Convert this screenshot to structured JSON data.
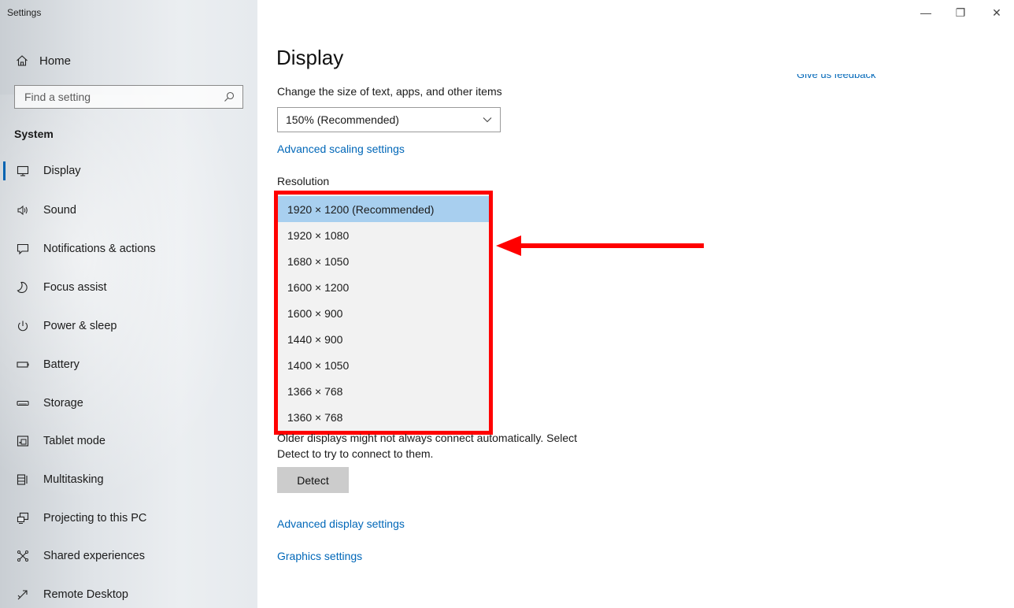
{
  "window": {
    "title": "Settings",
    "minimize_glyph": "—",
    "restore_glyph": "❐",
    "close_glyph": "✕"
  },
  "sidebar": {
    "home_label": "Home",
    "search_placeholder": "Find a setting",
    "section_label": "System",
    "items": [
      {
        "label": "Display",
        "icon": "monitor-icon",
        "active": true
      },
      {
        "label": "Sound",
        "icon": "speaker-icon"
      },
      {
        "label": "Notifications & actions",
        "icon": "notification-icon"
      },
      {
        "label": "Focus assist",
        "icon": "moon-icon"
      },
      {
        "label": "Power & sleep",
        "icon": "power-icon"
      },
      {
        "label": "Battery",
        "icon": "battery-icon"
      },
      {
        "label": "Storage",
        "icon": "storage-icon"
      },
      {
        "label": "Tablet mode",
        "icon": "tablet-mode-icon"
      },
      {
        "label": "Multitasking",
        "icon": "multitasking-icon"
      },
      {
        "label": "Projecting to this PC",
        "icon": "projecting-icon"
      },
      {
        "label": "Shared experiences",
        "icon": "shared-experiences-icon"
      },
      {
        "label": "Remote Desktop",
        "icon": "remote-desktop-icon"
      }
    ]
  },
  "main": {
    "title": "Display",
    "feedback_link": "Give us feedback",
    "scale_label": "Change the size of text, apps, and other items",
    "scale_value": "150% (Recommended)",
    "advanced_scaling_link": "Advanced scaling settings",
    "resolution_label": "Resolution",
    "resolution_options": [
      "1920 × 1200 (Recommended)",
      "1920 × 1080",
      "1680 × 1050",
      "1600 × 1200",
      "1600 × 900",
      "1440 × 900",
      "1400 × 1050",
      "1366 × 768",
      "1360 × 768"
    ],
    "resolution_selected": "1920 × 1200 (Recommended)",
    "detect_text_line1": "Older displays might not always connect automatically. Select",
    "detect_text_line2": "Detect to try to connect to them.",
    "detect_button": "Detect",
    "advanced_display_link": "Advanced display settings",
    "graphics_link": "Graphics settings"
  },
  "annotation": {
    "highlight_color": "#ff0000"
  }
}
